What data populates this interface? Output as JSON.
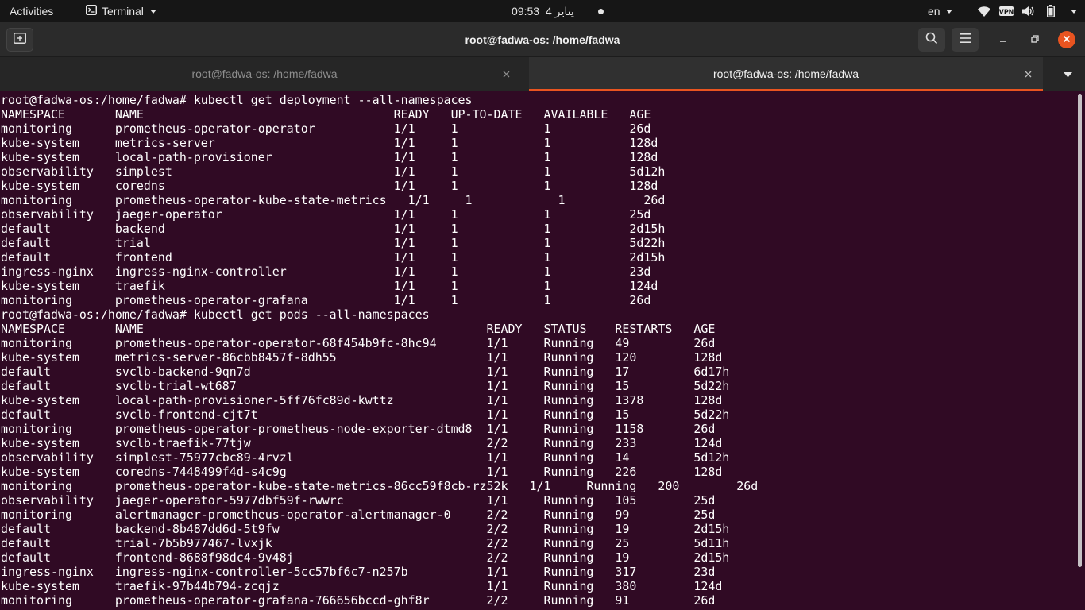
{
  "topbar": {
    "activities": "Activities",
    "app_menu": "Terminal",
    "clock_time": "09:53",
    "clock_date": "4 يناير",
    "language": "en",
    "tray_icons": [
      "wifi-icon",
      "vpn-icon",
      "volume-icon",
      "battery-icon",
      "system-menu-icon"
    ]
  },
  "window": {
    "title": "root@fadwa-os: /home/fadwa"
  },
  "tabs": [
    {
      "label": "root@fadwa-os: /home/fadwa",
      "active": false
    },
    {
      "label": "root@fadwa-os: /home/fadwa",
      "active": true
    }
  ],
  "colors": {
    "terminal_bg": "#300a24",
    "accent": "#e95420",
    "topbar_bg": "#161616",
    "headerbar_bg": "#2b2b2b"
  },
  "terminal": {
    "lines": [
      "root@fadwa-os:/home/fadwa# kubectl get deployment --all-namespaces",
      "NAMESPACE       NAME                                   READY   UP-TO-DATE   AVAILABLE   AGE",
      "monitoring      prometheus-operator-operator           1/1     1            1           26d",
      "kube-system     metrics-server                         1/1     1            1           128d",
      "kube-system     local-path-provisioner                 1/1     1            1           128d",
      "observability   simplest                               1/1     1            1           5d12h",
      "kube-system     coredns                                1/1     1            1           128d",
      "monitoring      prometheus-operator-kube-state-metrics   1/1     1            1           26d",
      "observability   jaeger-operator                        1/1     1            1           25d",
      "default         backend                                1/1     1            1           2d15h",
      "default         trial                                  1/1     1            1           5d22h",
      "default         frontend                               1/1     1            1           2d15h",
      "ingress-nginx   ingress-nginx-controller               1/1     1            1           23d",
      "kube-system     traefik                                1/1     1            1           124d",
      "monitoring      prometheus-operator-grafana            1/1     1            1           26d",
      "root@fadwa-os:/home/fadwa# kubectl get pods --all-namespaces",
      "NAMESPACE       NAME                                                READY   STATUS    RESTARTS   AGE",
      "monitoring      prometheus-operator-operator-68f454b9fc-8hc94       1/1     Running   49         26d",
      "kube-system     metrics-server-86cbb8457f-8dh55                     1/1     Running   120        128d",
      "default         svclb-backend-9qn7d                                 1/1     Running   17         6d17h",
      "default         svclb-trial-wt687                                   1/1     Running   15         5d22h",
      "kube-system     local-path-provisioner-5ff76fc89d-kwttz             1/1     Running   1378       128d",
      "default         svclb-frontend-cjt7t                                1/1     Running   15         5d22h",
      "monitoring      prometheus-operator-prometheus-node-exporter-dtmd8  1/1     Running   1158       26d",
      "kube-system     svclb-traefik-77tjw                                 2/2     Running   233        124d",
      "observability   simplest-75977cbc89-4rvzl                           1/1     Running   14         5d12h",
      "kube-system     coredns-7448499f4d-s4c9g                            1/1     Running   226        128d",
      "monitoring      prometheus-operator-kube-state-metrics-86cc59f8cb-rz52k   1/1     Running   200        26d",
      "observability   jaeger-operator-5977dbf59f-rwwrc                    1/1     Running   105        25d",
      "monitoring      alertmanager-prometheus-operator-alertmanager-0     2/2     Running   99         25d",
      "default         backend-8b487dd6d-5t9fw                             2/2     Running   19         2d15h",
      "default         trial-7b5b977467-lvxjk                              2/2     Running   25         5d11h",
      "default         frontend-8688f98dc4-9v48j                           2/2     Running   19         2d15h",
      "ingress-nginx   ingress-nginx-controller-5cc57bf6c7-n257b           1/1     Running   317        23d",
      "kube-system     traefik-97b44b794-zcqjz                             1/1     Running   380        124d",
      "monitoring      prometheus-operator-grafana-766656bccd-ghf8r        2/2     Running   91         26d"
    ]
  }
}
